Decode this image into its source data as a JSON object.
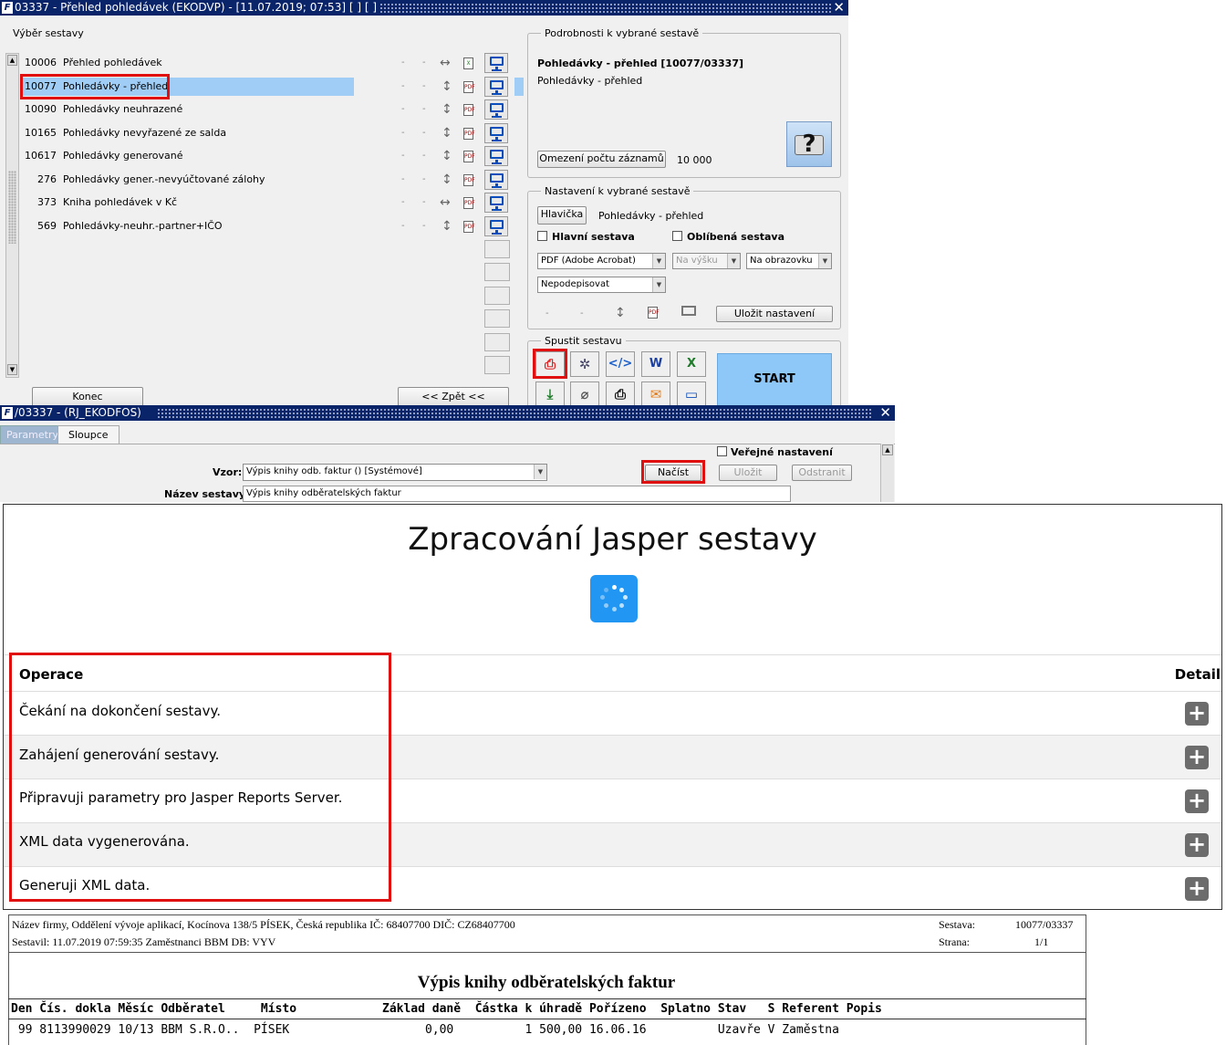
{
  "window1": {
    "title": "03337 - Přehled pohledávek (EKODVP) - [11.07.2019; 07:53]  [ ]  [ ]",
    "select_group": "Výběr sestavy",
    "reports": [
      {
        "code": "10006",
        "name": "Přehled pohledávek",
        "c1": "-",
        "c2": "-",
        "orient": "↔",
        "out": "excel"
      },
      {
        "code": "10077",
        "name": "Pohledávky - přehled",
        "c1": "-",
        "c2": "-",
        "orient": "↕",
        "out": "pdf"
      },
      {
        "code": "10090",
        "name": "Pohledávky neuhrazené",
        "c1": "-",
        "c2": "-",
        "orient": "↕",
        "out": "pdf"
      },
      {
        "code": "10165",
        "name": "Pohledávky nevyřazené ze salda",
        "c1": "-",
        "c2": "-",
        "orient": "↕",
        "out": "pdf"
      },
      {
        "code": "10617",
        "name": "Pohledávky generované",
        "c1": "-",
        "c2": "-",
        "orient": "↕",
        "out": "pdf"
      },
      {
        "code": "276",
        "name": "Pohledávky gener.-nevyúčtované zálohy",
        "c1": "-",
        "c2": "-",
        "orient": "↕",
        "out": "pdf"
      },
      {
        "code": "373",
        "name": "Kniha pohledávek v Kč",
        "c1": "-",
        "c2": "-",
        "orient": "↔",
        "out": "pdf"
      },
      {
        "code": "569",
        "name": "Pohledávky-neuhr.-partner+IČO",
        "c1": "-",
        "c2": "-",
        "orient": "↕",
        "out": "pdf"
      }
    ],
    "konec": "Konec",
    "zpet": "<< Zpět <<",
    "details_group": "Podrobnosti k vybrané sestavě",
    "details_title": "Pohledávky - přehled [10077/03337]",
    "details_sub": "Pohledávky - přehled",
    "limit_btn": "Omezení počtu záznamů",
    "limit_val": "10 000",
    "settings_group": "Nastavení k vybrané sestavě",
    "hlavicka_btn": "Hlavička",
    "hlavicka_val": "Pohledávky - přehled",
    "main_report": "Hlavní sestava",
    "fav_report": "Oblíbená sestava",
    "format": "PDF (Adobe Acrobat)",
    "orientation": "Na výšku",
    "output": "Na obrazovku",
    "sign": "Nepodepisovat",
    "save_settings": "Uložit nastavení",
    "run_group": "Spustit sestavu",
    "start": "START"
  },
  "window2": {
    "title": "/03337 - (RJ_EKODFOS)",
    "tab_params": "Parametry",
    "tab_columns": "Sloupce",
    "public": "Veřejné nastavení",
    "vzor_label": "Vzor:",
    "vzor_value": "Výpis knihy odb. faktur   ()   [Systémové]",
    "nacist": "Načíst",
    "ulozit": "Uložit",
    "odstranit": "Odstranit",
    "nazev_label": "Název sestavy:",
    "nazev_value": "Výpis knihy odběratelských faktur"
  },
  "processing": {
    "title": "Zpracování Jasper sestavy",
    "col_op": "Operace",
    "col_detail": "Detail",
    "ops": [
      "Čekání na dokončení sestavy.",
      "Zahájení generování sestavy.",
      "Připravuji parametry pro Jasper Reports Server.",
      "XML data vygenerována.",
      "Generuji XML data."
    ]
  },
  "report": {
    "company": "Název firmy, Oddělení vývoje aplikací, Kocínova 138/5 PÍSEK, Česká republika  IČ: 68407700  DIČ: CZ68407700",
    "made": "Sestavil: 11.07.2019 07:59:35 Zaměstnanci BBM  DB: VYV",
    "sestava_l": "Sestava:",
    "sestava_v": "10077/03337",
    "strana_l": "Strana:",
    "strana_v": "1/1",
    "title": "Výpis knihy odběratelských faktur",
    "header": "Den Čís. dokla Měsíc Odběratel     Místo            Základ daně  Částka k úhradě Pořízeno  Splatno Stav   S Referent Popis",
    "row": " 99 8113990029 10/13 BBM S.R.O..  PÍSEK                   0,00          1 500,00 16.06.16          Uzavře V Zaměstna"
  }
}
